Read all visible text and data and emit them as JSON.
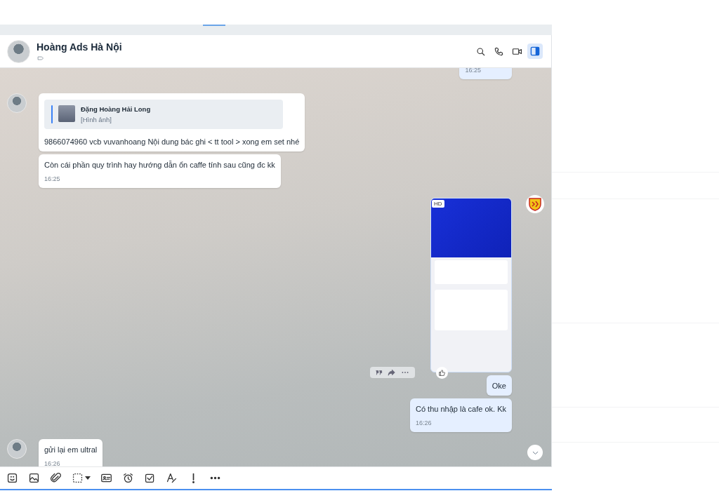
{
  "header": {
    "name": "Hoàng Ads Hà Nội",
    "info_panel_open": true
  },
  "messages": [
    {
      "kind": "time_only",
      "outgoing": true,
      "avatar": false,
      "time": "16:25"
    },
    {
      "kind": "reply",
      "outgoing": false,
      "avatar": true,
      "quote": {
        "author": "Đặng Hoàng Hải Long",
        "caption": "[Hình ảnh]"
      },
      "text": "9866074960 vcb vuvanhoang Nội dung bác ghi < tt tool > xong em set nhé"
    },
    {
      "kind": "text",
      "outgoing": false,
      "avatar": false,
      "text": "Còn cái phần quy trình hay hướng dẫn ổn caffe tính sau cũng đc  kk",
      "time": "16:25"
    },
    {
      "kind": "image",
      "outgoing": true,
      "avatar": true,
      "badge": "HD"
    },
    {
      "kind": "text",
      "outgoing": true,
      "avatar": false,
      "text": "Oke"
    },
    {
      "kind": "text",
      "outgoing": true,
      "avatar": false,
      "text": "Có thu nhập là cafe ok. Kk",
      "time": "16:26"
    },
    {
      "kind": "text",
      "outgoing": false,
      "avatar": true,
      "text": "gửi lại em ultral",
      "time": "16:26"
    }
  ]
}
